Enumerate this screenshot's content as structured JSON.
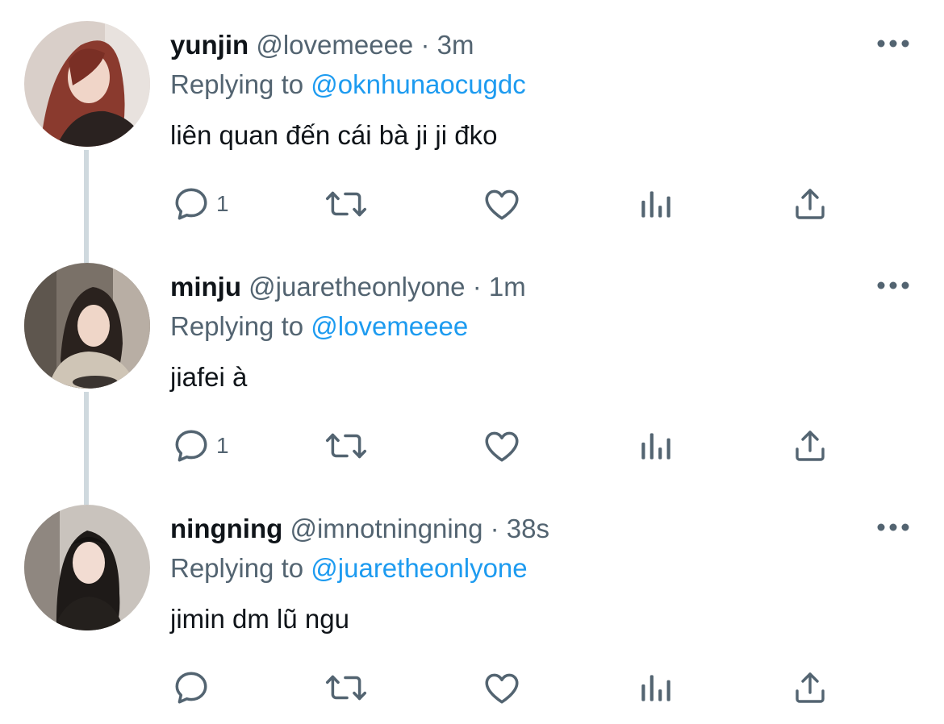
{
  "colors": {
    "text_primary": "#0f1419",
    "text_secondary": "#536471",
    "accent": "#1d9bf0",
    "thread_line": "#cfd9de"
  },
  "tweets": [
    {
      "name": "yunjin",
      "handle": "@lovemeeee",
      "separator": "·",
      "time": "3m",
      "replying_prefix": "Replying to",
      "replying_to": "@oknhunaocugdc",
      "text": "liên quan đến cái bà ji ji đko",
      "reply_count": "1"
    },
    {
      "name": "minju",
      "handle": "@juaretheonlyone",
      "separator": "·",
      "time": "1m",
      "replying_prefix": "Replying to",
      "replying_to": "@lovemeeee",
      "text": "jiafei à",
      "reply_count": "1"
    },
    {
      "name": "ningning",
      "handle": "@imnotningning",
      "separator": "·",
      "time": "38s",
      "replying_prefix": "Replying to",
      "replying_to": "@juaretheonlyone",
      "text": "jimin dm lũ ngu",
      "reply_count": ""
    }
  ],
  "icons": {
    "reply": "reply-icon",
    "retweet": "retweet-icon",
    "like": "like-icon",
    "analytics": "analytics-icon",
    "share": "share-icon",
    "more": "more-icon"
  }
}
